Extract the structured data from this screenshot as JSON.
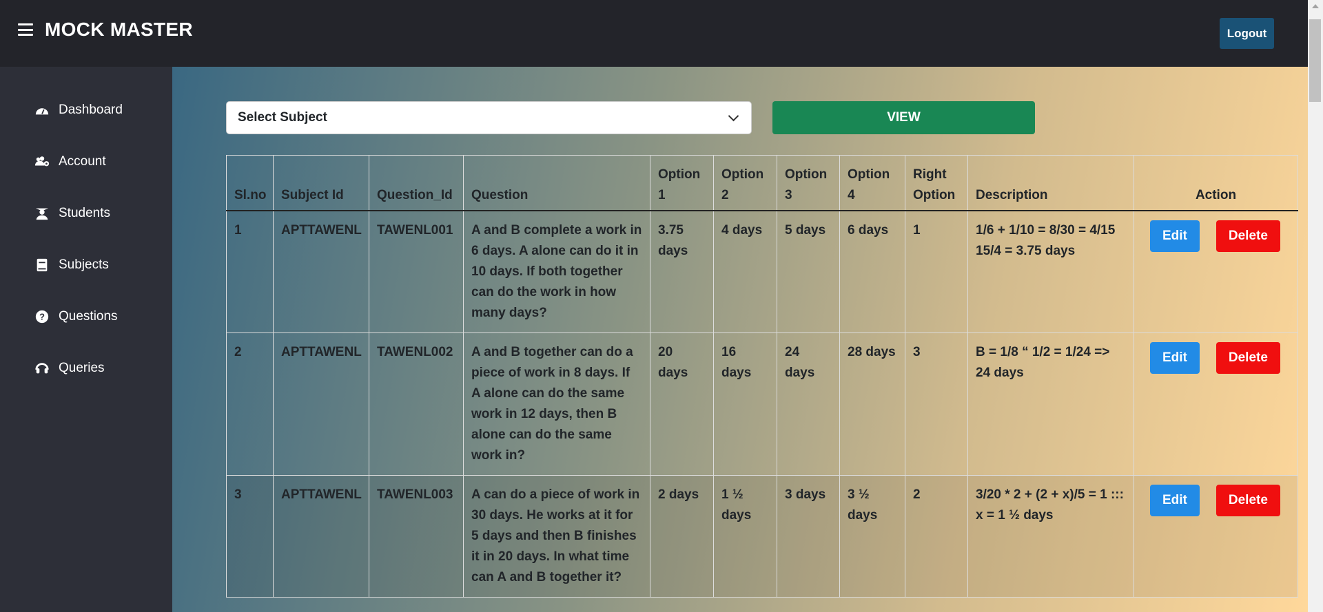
{
  "header": {
    "title": "MOCK MASTER",
    "logout_label": "Logout"
  },
  "sidebar": {
    "items": [
      {
        "label": "Dashboard",
        "icon": "dashboard-icon"
      },
      {
        "label": "Account",
        "icon": "users-cog-icon"
      },
      {
        "label": "Students",
        "icon": "graduate-icon"
      },
      {
        "label": "Subjects",
        "icon": "book-icon"
      },
      {
        "label": "Questions",
        "icon": "question-circle-icon"
      },
      {
        "label": "Queries",
        "icon": "headset-icon"
      }
    ]
  },
  "filter": {
    "select_value": "Select Subject",
    "view_label": "VIEW"
  },
  "table": {
    "headers": [
      "Sl.no",
      "Subject Id",
      "Question_Id",
      "Question",
      "Option 1",
      "Option 2",
      "Option 3",
      "Option 4",
      "Right Option",
      "Description",
      "Action"
    ],
    "rows": [
      {
        "slno": "1",
        "subject_id": "APTTAWENL",
        "question_id": "TAWENL001",
        "question": "A and B complete a work in 6 days. A alone can do it in 10 days. If both together can do the work in how many days?",
        "opt1": "3.75 days",
        "opt2": "4 days",
        "opt3": "5 days",
        "opt4": "6 days",
        "right": "1",
        "description": "1/6 + 1/10 = 8/30 = 4/15 15/4 = 3.75 days",
        "edit": "Edit",
        "delete": "Delete"
      },
      {
        "slno": "2",
        "subject_id": "APTTAWENL",
        "question_id": "TAWENL002",
        "question": "A and B together can do a piece of work in 8 days. If A alone can do the same work in 12 days, then B alone can do the same work in?",
        "opt1": "20 days",
        "opt2": "16 days",
        "opt3": "24 days",
        "opt4": "28 days",
        "right": "3",
        "description": "B = 1/8 “ 1/2 = 1/24 => 24 days",
        "edit": "Edit",
        "delete": "Delete"
      },
      {
        "slno": "3",
        "subject_id": "APTTAWENL",
        "question_id": "TAWENL003",
        "question": "A can do a piece of work in 30 days. He works at it for 5 days and then B finishes it in 20 days. In what time can A and B together it?",
        "opt1": "2 days",
        "opt2": "1 ½ days",
        "opt3": "3 days",
        "opt4": "3 ½ days",
        "right": "2",
        "description": "3/20 * 2 + (2 + x)/5 = 1 ::: x = 1 ½ days",
        "edit": "Edit",
        "delete": "Delete"
      }
    ]
  },
  "colors": {
    "header_bg": "#23242a",
    "sidebar_bg": "#2d2f38",
    "view": "#198754",
    "edit": "#228be6",
    "delete": "#f00f0f",
    "logout": "#1a5276"
  }
}
